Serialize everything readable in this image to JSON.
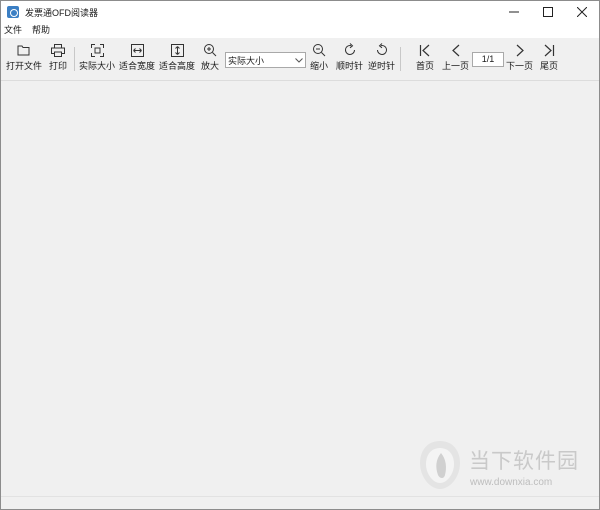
{
  "window": {
    "title": "发票通OFD阅读器"
  },
  "menu": {
    "items": [
      "文件",
      "帮助"
    ]
  },
  "toolbar": {
    "open_file": "打开文件",
    "print": "打印",
    "actual_size": "实际大小",
    "fit_width": "适合宽度",
    "fit_height": "适合高度",
    "zoom_in": "放大",
    "zoom_select_value": "实际大小",
    "zoom_out": "缩小",
    "rotate_cw": "顺时针",
    "rotate_ccw": "逆时针",
    "first_page": "首页",
    "prev_page": "上一页",
    "page_indicator": "1/1",
    "next_page": "下一页",
    "last_page": "尾页"
  },
  "watermark": {
    "title": "当下软件园",
    "url": "www.downxia.com"
  },
  "colors": {
    "accent": "#3b7fc4",
    "workspace_bg": "#f0f0f0",
    "watermark": "#c9c9c9"
  }
}
